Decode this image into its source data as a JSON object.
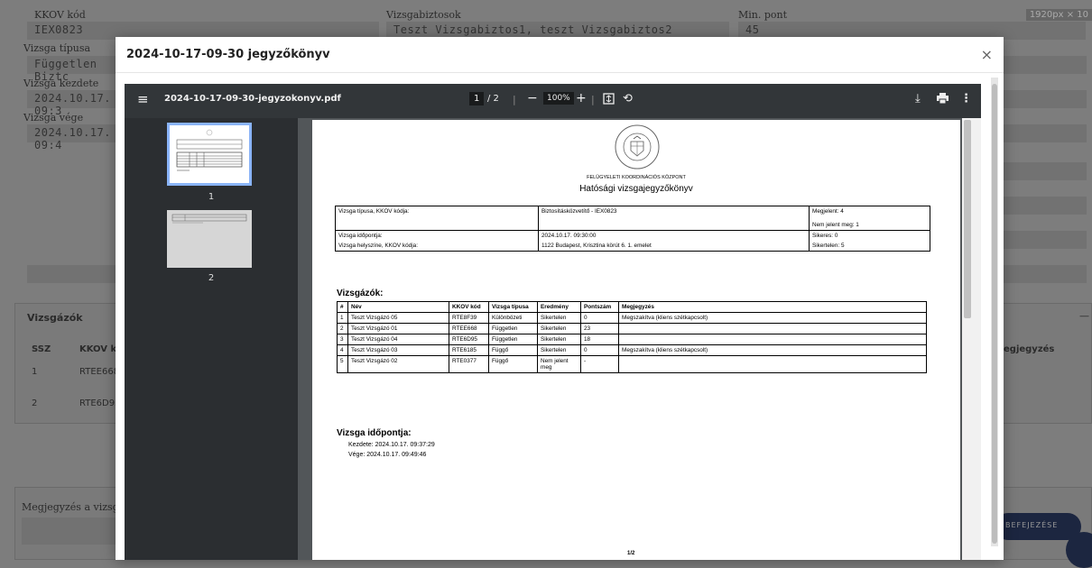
{
  "background": {
    "kkov_kod_label": "KKOV kód",
    "kkov_kod_value": "IEX0823",
    "vizsgabiztosok_label": "Vizsgabiztosok",
    "vizsgabiztosok_value": "Teszt Vizsgabiztos1, teszt Vizsgabiztos2",
    "min_pont_label": "Min. pont",
    "min_pont_value": "45",
    "vizsga_tipusa_label": "Vizsga típusa",
    "vizsga_tipusa_value": "Független Biztc",
    "vizsga_kezdete_label": "Vizsga kezdete",
    "vizsga_kezdete_value": "2024.10.17. 09:3",
    "vizsga_vege_label": "Vizsga vége",
    "vizsga_vege_value": "2024.10.17. 09:4",
    "vizsgazok_title": "Vizsgázók",
    "col_ssz": "SSZ",
    "col_kkov": "KKOV kó",
    "col_megjegyzes": "egjegyzés",
    "rows": [
      {
        "ssz": "1",
        "kkov": "RTEE668"
      },
      {
        "ssz": "2",
        "kkov": "RTE6D95"
      }
    ],
    "megjegyzes_label": "Megjegyzés a vizsgáho",
    "finish_button": "BEFEJEZÉSE",
    "dimension_badge": "1920px × 10",
    "collapse_icon": "—"
  },
  "modal": {
    "title": "2024-10-17-09-30 jegyzőkönyv",
    "close": "×"
  },
  "pdf": {
    "filename": "2024-10-17-09-30-jegyzokonyv.pdf",
    "page_current": "1",
    "page_total": "/ 2",
    "zoom": "100%",
    "thumbs": [
      "1",
      "2"
    ],
    "footer_page": "1/2"
  },
  "doc": {
    "org": "FELÜGYELETI KOORDINÁCIÓS KÖZPONT",
    "title": "Hatósági vizsgajegyzőkönyv",
    "info": {
      "r1c1": "Vizsga típusa, KKOV kódja:",
      "r1c2": "Biztosításközvetítő - IEX0823",
      "r1c3a": "Megjelent: 4",
      "r1c3b": "Nem jelent meg: 1",
      "r2c1": "Vizsga időpontja:",
      "r2c2": "2024.10.17. 09:30:00",
      "r2c3": "Sikeres: 0",
      "r3c1": "Vizsga helyszíne, KKOV kódja:",
      "r3c2": "1122 Budapest, Krisztina körút 6. 1. emelet",
      "r3c3": "Sikertelen: 5"
    },
    "vizsgazok_heading": "Vizsgázók:",
    "headers": [
      "#",
      "Név",
      "KKOV kód",
      "Vizsga típusa",
      "Eredmény",
      "Pontszám",
      "Megjegyzés"
    ],
    "rows": [
      [
        "1",
        "Teszt Vizsgázó 05",
        "RTE8F39",
        "Különbözeti",
        "Sikertelen",
        "0",
        "Megszakítva (kliens szétkapcsolt)"
      ],
      [
        "2",
        "Teszt Vizsgázó 01",
        "RTEE668",
        "Független",
        "Sikertelen",
        "23",
        ""
      ],
      [
        "3",
        "Teszt Vizsgázó 04",
        "RTE6D95",
        "Független",
        "Sikertelen",
        "18",
        ""
      ],
      [
        "4",
        "Teszt Vizsgázó 03",
        "RTE6185",
        "Függő",
        "Sikertelen",
        "0",
        "Megszakítva (kliens szétkapcsolt)"
      ],
      [
        "5",
        "Teszt Vizsgázó 02",
        "RTE0377",
        "Függő",
        "Nem jelent meg",
        "-",
        ""
      ]
    ],
    "idopont_heading": "Vizsga időpontja:",
    "kezdete": "Kezdete: 2024.10.17. 09:37:29",
    "vege": "Vége: 2024.10.17. 09:49:46"
  }
}
